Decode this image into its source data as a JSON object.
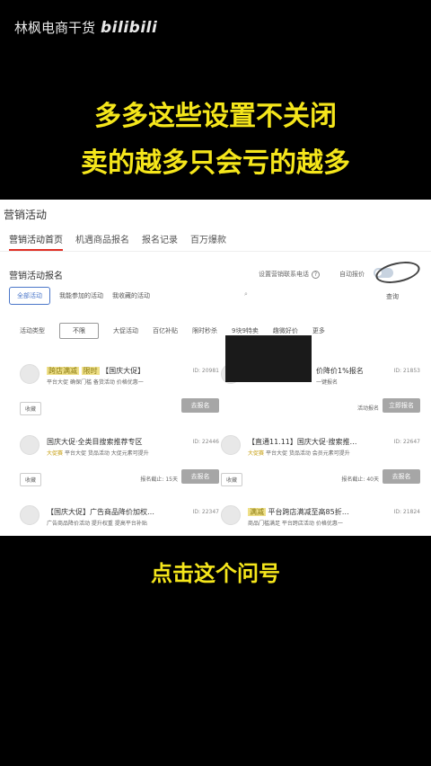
{
  "watermark": {
    "author": "林枫电商干货",
    "logo": "bilibili"
  },
  "headline": {
    "line1": "多多这些设置不关闭",
    "line2": "卖的越多只会亏的越多"
  },
  "caption": "点击这个问号",
  "screen": {
    "title": "营销活动",
    "tabs": [
      "营销活动首页",
      "机遇商品报名",
      "报名记录",
      "百万爆款"
    ],
    "section_title": "营销活动报名",
    "settings_link": "设置营销联系电话",
    "auto_label": "自动报价",
    "filters": [
      "全部活动",
      "我能参加的活动",
      "我收藏的活动"
    ],
    "search_btn": "查询",
    "chips": {
      "label": "活动类型",
      "selected": "不限",
      "items": [
        "大促活动",
        "百亿补贴",
        "限时秒杀",
        "9块9特卖",
        "趣微好价",
        "更多"
      ]
    },
    "cards": [
      {
        "title_pre": "【国庆大促】",
        "hl": [
          "跨店满减",
          "限时"
        ],
        "id": "ID: 20981",
        "meta_tag": "平台大促",
        "meta": "确保门槛 备货活动 价格优惠一",
        "fav": "收藏",
        "end": "",
        "btn": "去报名"
      },
      {
        "title_pre": "价降价1%报名",
        "hl": [],
        "id": "ID: 21853",
        "meta_tag": "",
        "meta": "一键报名",
        "fav": "",
        "end": "活动报名",
        "btn": "立即报名"
      },
      {
        "title_pre": "国庆大促·全类目搜索推荐专区",
        "hl": [],
        "id": "ID: 22446",
        "meta_tag": "大促赛",
        "meta": "平台大促 货品活动 大促元素可提升",
        "fav": "收藏",
        "end": "报名截止: 15天",
        "btn": "去报名"
      },
      {
        "title_pre": "【直通11.11】国庆大促·搜索推…",
        "hl": [],
        "id": "ID: 22647",
        "meta_tag": "大促赛",
        "meta": "平台大促 货品活动 会员元素可提升",
        "fav": "收藏",
        "end": "报名截止: 40天",
        "btn": "去报名"
      },
      {
        "title_pre": "【国庆大促】广告商品降价加权…",
        "hl": [],
        "id": "ID: 22347",
        "meta_tag": "",
        "meta": "广告商品降价活动 提升权重 提高平台补贴",
        "fav": "",
        "end": "",
        "btn": ""
      },
      {
        "title_pre": "平台跨店满减至高85折…",
        "hl": [
          "满减"
        ],
        "id": "ID: 21824",
        "meta_tag": "",
        "meta": "商品门槛满足 平台跨店活动 价格优惠一",
        "fav": "",
        "end": "",
        "btn": ""
      }
    ]
  }
}
